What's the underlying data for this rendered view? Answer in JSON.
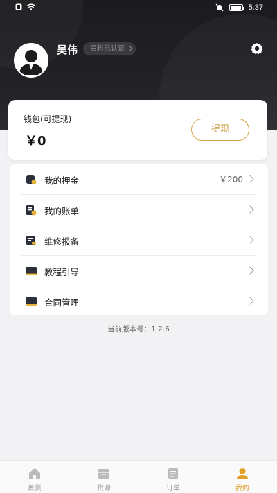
{
  "status_bar": {
    "time": "5:37",
    "icons": [
      "notification-icon",
      "wifi-icon",
      "mute-icon",
      "battery-icon"
    ]
  },
  "profile": {
    "name": "吴伟",
    "verified_label": "资料已认证",
    "icons": [
      "avatar-icon",
      "settings-icon"
    ]
  },
  "wallet": {
    "title": "钱包(可提现)",
    "amount": "￥0",
    "withdraw_label": "提现"
  },
  "menu": {
    "items": [
      {
        "label": "我的押金",
        "value": "￥200",
        "icon": "deposit-icon"
      },
      {
        "label": "我的账单",
        "value": "",
        "icon": "bill-icon"
      },
      {
        "label": "维修报备",
        "value": "",
        "icon": "repair-icon"
      },
      {
        "label": "教程引导",
        "value": "",
        "icon": "tutorial-icon"
      },
      {
        "label": "合同管理",
        "value": "",
        "icon": "contract-icon"
      }
    ]
  },
  "version_text": "当前版本号：1.2.6",
  "tabs": [
    {
      "label": "首页",
      "icon": "home-icon",
      "active": false
    },
    {
      "label": "货源",
      "icon": "goods-icon",
      "active": false
    },
    {
      "label": "订单",
      "icon": "order-icon",
      "active": false
    },
    {
      "label": "我的",
      "icon": "profile-icon",
      "active": true
    }
  ],
  "colors": {
    "header_dark": "#1b1b1f",
    "accent_gold": "#d89a1c",
    "page_bg": "#f2f2f4"
  }
}
